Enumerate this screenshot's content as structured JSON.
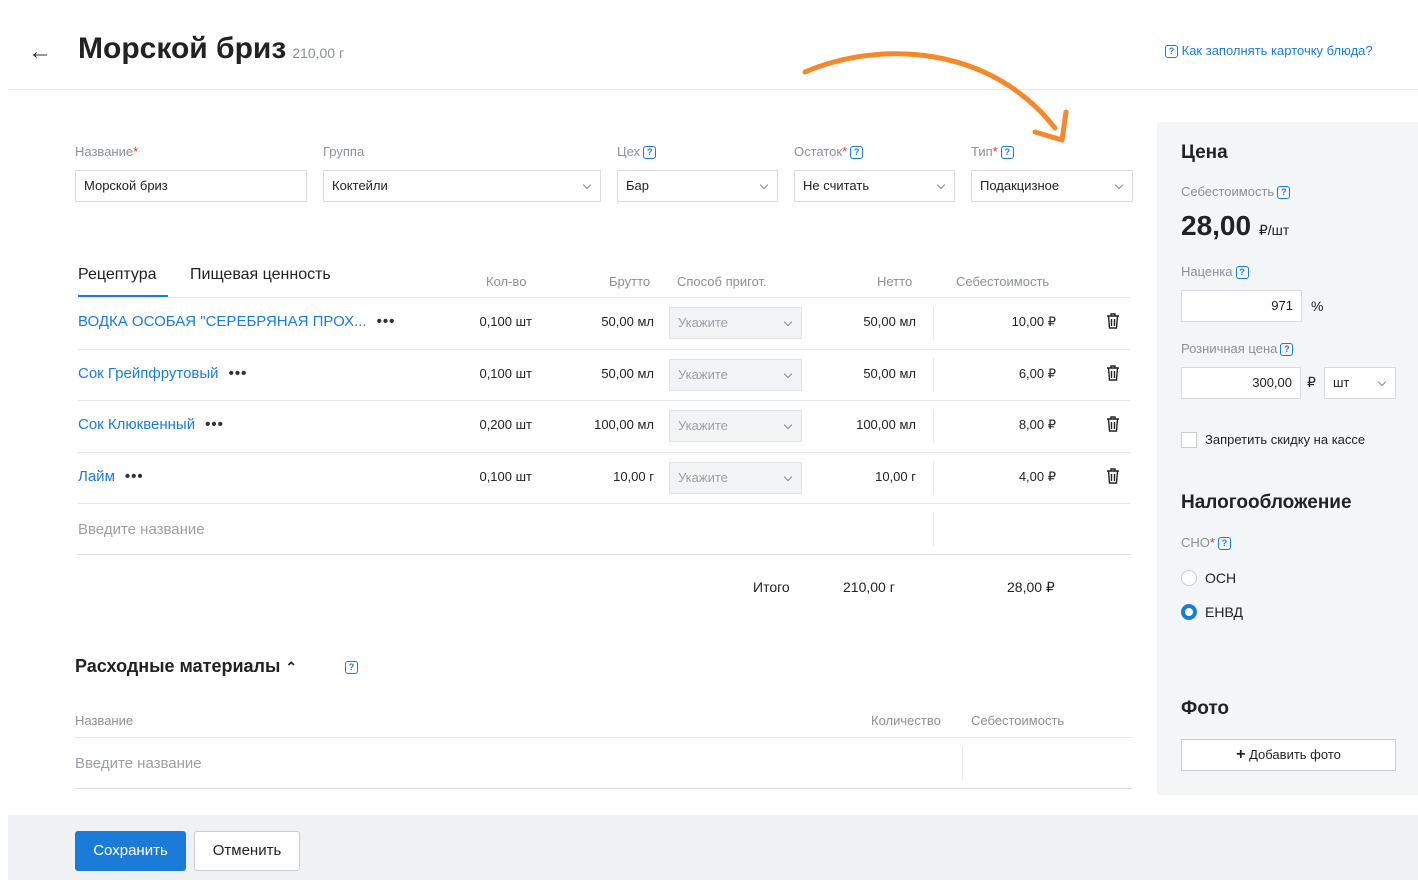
{
  "header": {
    "back_icon": "arrow-left-icon",
    "title": "Морской бриз",
    "weight": "210,00 г",
    "help_link": "Как заполнять карточку блюда?"
  },
  "form": {
    "name": {
      "label": "Название",
      "value": "Морской бриз"
    },
    "group": {
      "label": "Группа",
      "value": "Коктейли"
    },
    "workshop": {
      "label": "Цех",
      "value": "Бар"
    },
    "stock": {
      "label": "Остаток",
      "value": "Не считать"
    },
    "type": {
      "label": "Тип",
      "value": "Подакцизное"
    }
  },
  "recipe": {
    "tabs": [
      "Рецептура",
      "Пищевая ценность"
    ],
    "columns": {
      "qty": "Кол-во",
      "gross": "Брутто",
      "method": "Способ пригот.",
      "net": "Нетто",
      "cost": "Себестоимость"
    },
    "rows": [
      {
        "name": "ВОДКА ОСОБАЯ \"СЕРЕБРЯНАЯ ПРОХ...",
        "qty": "0,100 шт",
        "gross": "50,00 мл",
        "method": "Укажите",
        "net": "50,00 мл",
        "cost": "10,00 ₽"
      },
      {
        "name": "Сок Грейпфрутовый",
        "qty": "0,100 шт",
        "gross": "50,00 мл",
        "method": "Укажите",
        "net": "50,00 мл",
        "cost": "6,00 ₽"
      },
      {
        "name": "Сок Клюквенный",
        "qty": "0,200 шт",
        "gross": "100,00 мл",
        "method": "Укажите",
        "net": "100,00 мл",
        "cost": "8,00 ₽"
      },
      {
        "name": "Лайм",
        "qty": "0,100 шт",
        "gross": "10,00 г",
        "method": "Укажите",
        "net": "10,00 г",
        "cost": "4,00 ₽"
      }
    ],
    "new_placeholder": "Введите название",
    "total_label": "Итого",
    "total_net": "210,00 г",
    "total_cost": "28,00 ₽"
  },
  "consumables": {
    "title": "Расходные материалы",
    "col_name": "Название",
    "col_qty": "Количество",
    "col_cost": "Себестоимость",
    "placeholder": "Введите название"
  },
  "price": {
    "title": "Цена",
    "cost_label": "Себестоимость",
    "cost_value": "28,00",
    "cost_unit": "₽/шт",
    "markup_label": "Наценка",
    "markup_value": "971",
    "markup_unit": "%",
    "retail_label": "Розничная цена",
    "retail_value": "300,00",
    "retail_currency": "₽",
    "retail_unit": "шт",
    "no_discount_label": "Запретить скидку на кассе"
  },
  "tax": {
    "title": "Налогообложение",
    "label": "СНО",
    "options": [
      "ОСН",
      "ЕНВД"
    ],
    "selected": "ЕНВД"
  },
  "photo": {
    "title": "Фото",
    "add_label": "Добавить фото"
  },
  "footer": {
    "save_label": "Сохранить",
    "cancel_label": "Отменить"
  },
  "colors": {
    "accent": "#1b7bd8",
    "annotation_arrow": "#f5882b"
  }
}
